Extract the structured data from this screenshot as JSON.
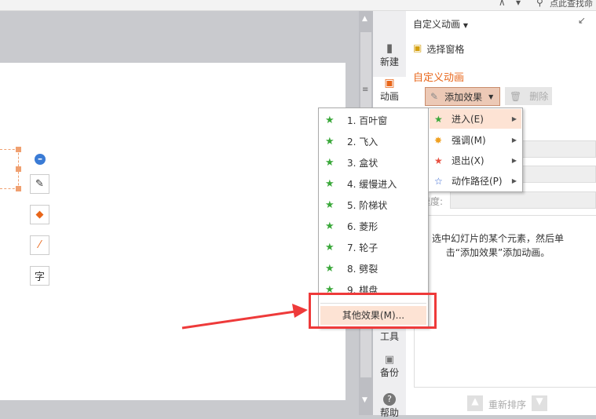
{
  "topbar": {
    "search_placeholder": "点此查找命"
  },
  "sidebar": {
    "items": [
      {
        "label": "新建"
      },
      {
        "label": "动画"
      },
      {
        "label": "工具"
      },
      {
        "label": "备份"
      },
      {
        "label": "帮助"
      }
    ]
  },
  "panel": {
    "title": "自定义动画",
    "select_pane": "选择窗格",
    "section_title": "自定义动画",
    "add_effect": "添加效果",
    "delete": "删除",
    "speed_label": "速度:",
    "hint": "选中幻灯片的某个元素，然后单击“添加效果”添加动画。",
    "reorder": "重新排序"
  },
  "menu": {
    "items": [
      {
        "label": "1. 百叶窗"
      },
      {
        "label": "2. 飞入"
      },
      {
        "label": "3. 盒状"
      },
      {
        "label": "4. 缓慢进入"
      },
      {
        "label": "5. 阶梯状"
      },
      {
        "label": "6. 菱形"
      },
      {
        "label": "7. 轮子"
      },
      {
        "label": "8. 劈裂"
      },
      {
        "label": "9. 棋盘"
      }
    ],
    "more": "其他效果(M)..."
  },
  "submenu": {
    "items": [
      {
        "label": "进入(E)",
        "color": "#3aa83a"
      },
      {
        "label": "强调(M)",
        "color": "#f0a020"
      },
      {
        "label": "退出(X)",
        "color": "#e85040"
      },
      {
        "label": "动作路径(P)",
        "color": "#3060d0"
      }
    ]
  },
  "colors": {
    "accent": "#e8661a",
    "highlight": "#fde3d4",
    "annotation": "#ee3a3a"
  }
}
